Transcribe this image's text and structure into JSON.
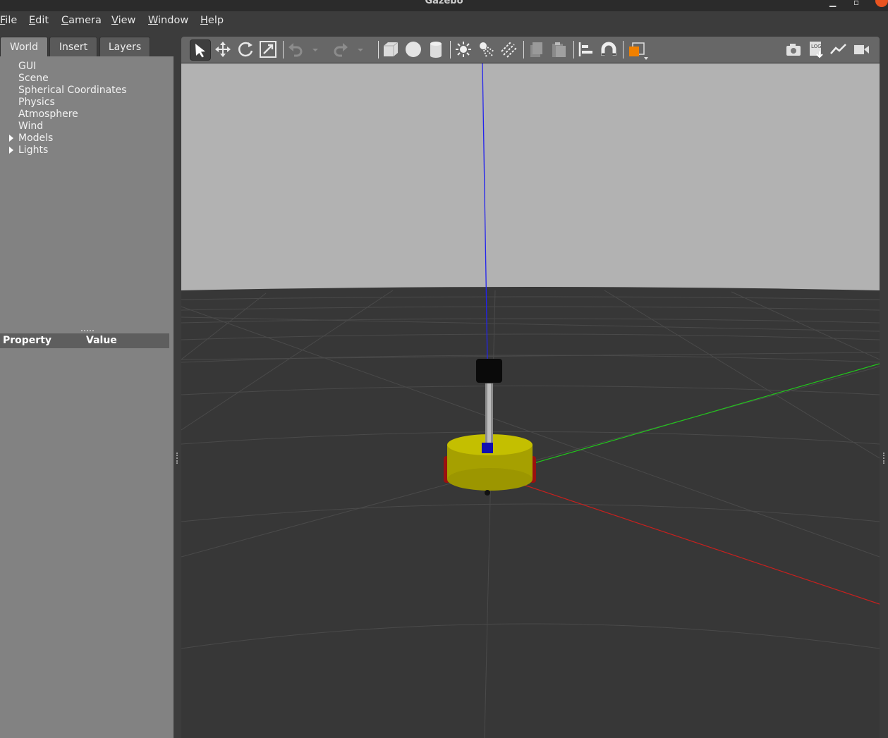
{
  "window": {
    "title": "Gazebo"
  },
  "menu": [
    "File",
    "Edit",
    "Camera",
    "View",
    "Window",
    "Help"
  ],
  "tabs": [
    "World",
    "Insert",
    "Layers"
  ],
  "tree": [
    "GUI",
    "Scene",
    "Spherical Coordinates",
    "Physics",
    "Atmosphere",
    "Wind",
    "Models",
    "Lights"
  ],
  "properties": {
    "col_property": "Property",
    "col_value": "Value"
  },
  "toolbar": {
    "icons": [
      "select-arrow-icon",
      "translate-icon",
      "rotate-icon",
      "scale-icon",
      "undo-icon",
      "undo-dropdown-icon",
      "redo-icon",
      "redo-dropdown-icon",
      "box-icon",
      "sphere-icon",
      "cylinder-icon",
      "point-light-icon",
      "spot-light-icon",
      "directional-light-icon",
      "copy-icon",
      "paste-icon",
      "align-icon",
      "snap-icon",
      "view-angle-icon",
      "screenshot-icon",
      "log-icon",
      "plot-icon",
      "video-record-icon"
    ],
    "log_label": "LOG"
  },
  "colors": {
    "sky": "#b2b2b2",
    "ground": "#373737",
    "robot_body": "#b5b000",
    "axis_x": "#c8201e",
    "axis_y": "#22c51c",
    "axis_z": "#2222ee",
    "view_angle_orange": "#f08000"
  }
}
